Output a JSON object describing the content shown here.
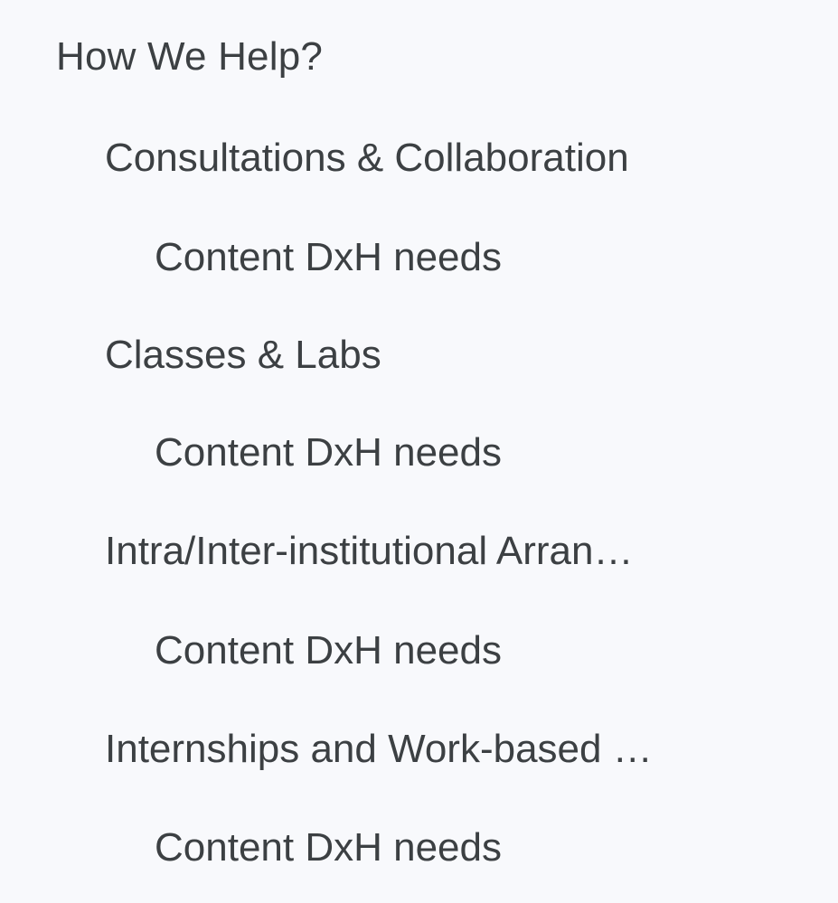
{
  "outline": {
    "heading": "How We Help?",
    "items": [
      {
        "label": "Consultations & Collaboration",
        "level": 1
      },
      {
        "label": "Content DxH needs",
        "level": 2
      },
      {
        "label": "Classes & Labs",
        "level": 1
      },
      {
        "label": "Content DxH needs",
        "level": 2
      },
      {
        "label": "Intra/Inter-institutional Arran…",
        "level": 1
      },
      {
        "label": "Content DxH needs",
        "level": 2
      },
      {
        "label": "Internships and Work-based …",
        "level": 1
      },
      {
        "label": "Content DxH needs",
        "level": 2
      }
    ]
  }
}
